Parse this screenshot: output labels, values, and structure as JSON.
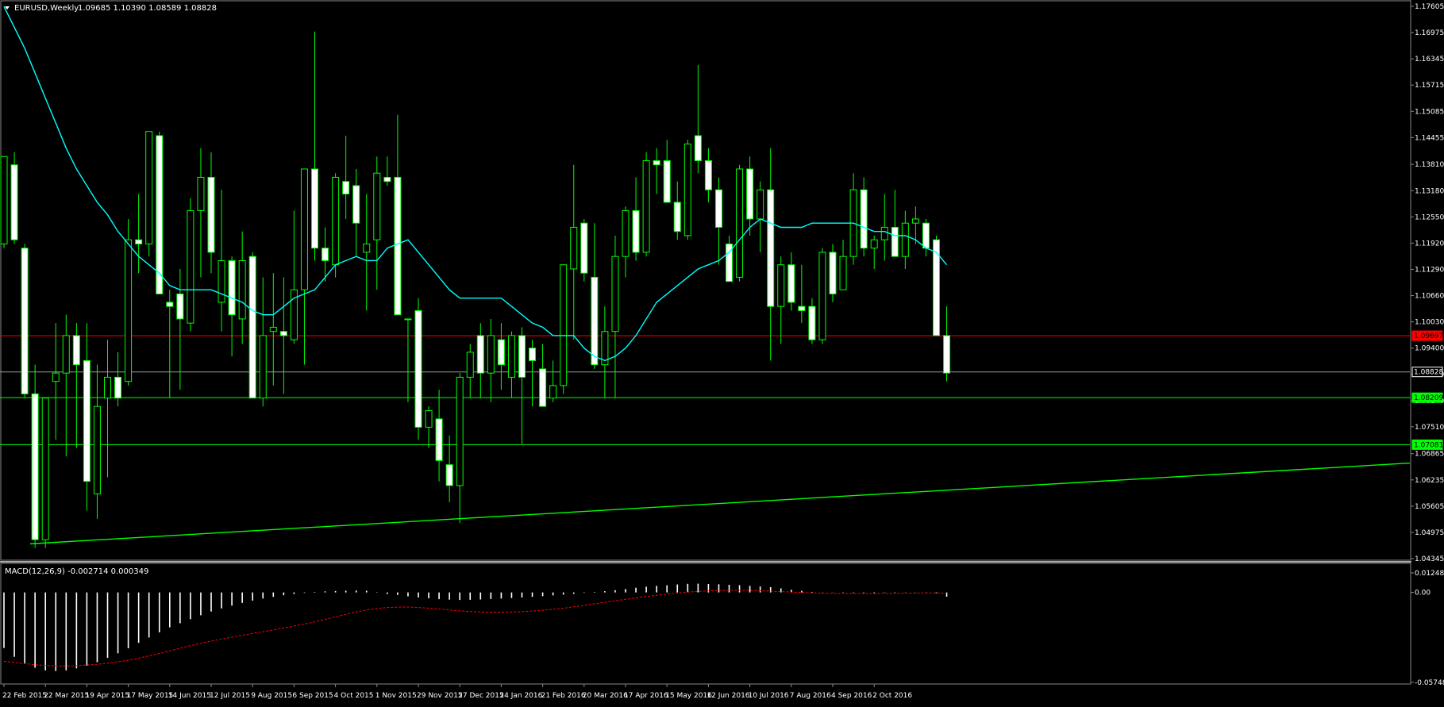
{
  "header": {
    "symbol_label": "EURUSD,Weekly",
    "ohlc_text": "1.09685 1.10390 1.08589 1.08828"
  },
  "macd_header": {
    "label": "MACD(12,26,9) -0.002714 0.000349"
  },
  "colors": {
    "background": "#000000",
    "bull_candle": "#000000",
    "bear_candle": "#ffffff",
    "wick": "#00ff00",
    "ma_line": "#00ffff",
    "red_level": "#ff0000",
    "green_level": "#00ff00",
    "macd_hist": "#ffffff",
    "macd_signal": "#ff0000",
    "axis_text": "#ffffff"
  },
  "chart_data": [
    {
      "type": "candlestick",
      "symbol": "EURUSD",
      "timeframe": "Weekly",
      "ylim": [
        1.04345,
        1.17605
      ],
      "y_ticks": [
        "1.17605",
        "1.16975",
        "1.16345",
        "1.15715",
        "1.15085",
        "1.14455",
        "1.13810",
        "1.13180",
        "1.12550",
        "1.11920",
        "1.11290",
        "1.10660",
        "1.10030",
        "1.09400",
        "1.08770",
        "1.08140",
        "1.07510",
        "1.06865",
        "1.06235",
        "1.05605",
        "1.04975",
        "1.04345"
      ],
      "x_labels": [
        "22 Feb 2015",
        "22 Mar 2015",
        "19 Apr 2015",
        "17 May 2015",
        "14 Jun 2015",
        "12 Jul 2015",
        "9 Aug 2015",
        "6 Sep 2015",
        "4 Oct 2015",
        "1 Nov 2015",
        "29 Nov 2015",
        "27 Dec 2015",
        "24 Jan 2016",
        "21 Feb 2016",
        "20 Mar 2016",
        "17 Apr 2016",
        "15 May 2016",
        "12 Jun 2016",
        "10 Jul 2016",
        "7 Aug 2016",
        "4 Sep 2016",
        "2 Oct 2016"
      ],
      "price_labels": [
        {
          "value": "1.09697",
          "kind": "red"
        },
        {
          "value": "1.08828",
          "kind": "current"
        },
        {
          "value": "1.08209",
          "kind": "green"
        },
        {
          "value": "1.07081",
          "kind": "green"
        }
      ],
      "horizontal_levels": [
        1.09697,
        1.08828,
        1.08209,
        1.07081
      ],
      "trendline": {
        "from": [
          0,
          1.047
        ],
        "to": [
          112,
          1.063
        ]
      },
      "candles": [
        {
          "o": 1.119,
          "h": 1.14,
          "l": 1.118,
          "c": 1.14
        },
        {
          "o": 1.138,
          "h": 1.141,
          "l": 1.119,
          "c": 1.12
        },
        {
          "o": 1.118,
          "h": 1.119,
          "l": 1.082,
          "c": 1.083
        },
        {
          "o": 1.083,
          "h": 1.09,
          "l": 1.046,
          "c": 1.048
        },
        {
          "o": 1.048,
          "h": 1.082,
          "l": 1.046,
          "c": 1.082
        },
        {
          "o": 1.086,
          "h": 1.1,
          "l": 1.072,
          "c": 1.088
        },
        {
          "o": 1.088,
          "h": 1.102,
          "l": 1.068,
          "c": 1.097
        },
        {
          "o": 1.097,
          "h": 1.1,
          "l": 1.07,
          "c": 1.09
        },
        {
          "o": 1.091,
          "h": 1.1,
          "l": 1.055,
          "c": 1.062
        },
        {
          "o": 1.059,
          "h": 1.09,
          "l": 1.053,
          "c": 1.08
        },
        {
          "o": 1.082,
          "h": 1.096,
          "l": 1.063,
          "c": 1.087
        },
        {
          "o": 1.087,
          "h": 1.093,
          "l": 1.08,
          "c": 1.082
        },
        {
          "o": 1.086,
          "h": 1.125,
          "l": 1.085,
          "c": 1.12
        },
        {
          "o": 1.12,
          "h": 1.131,
          "l": 1.112,
          "c": 1.119
        },
        {
          "o": 1.119,
          "h": 1.146,
          "l": 1.116,
          "c": 1.146
        },
        {
          "o": 1.145,
          "h": 1.146,
          "l": 1.107,
          "c": 1.107
        },
        {
          "o": 1.105,
          "h": 1.108,
          "l": 1.082,
          "c": 1.104
        },
        {
          "o": 1.107,
          "h": 1.113,
          "l": 1.084,
          "c": 1.101
        },
        {
          "o": 1.1,
          "h": 1.13,
          "l": 1.098,
          "c": 1.127
        },
        {
          "o": 1.127,
          "h": 1.142,
          "l": 1.111,
          "c": 1.135
        },
        {
          "o": 1.135,
          "h": 1.141,
          "l": 1.112,
          "c": 1.117
        },
        {
          "o": 1.105,
          "h": 1.132,
          "l": 1.098,
          "c": 1.115
        },
        {
          "o": 1.115,
          "h": 1.116,
          "l": 1.092,
          "c": 1.102
        },
        {
          "o": 1.101,
          "h": 1.122,
          "l": 1.095,
          "c": 1.115
        },
        {
          "o": 1.116,
          "h": 1.117,
          "l": 1.082,
          "c": 1.082
        },
        {
          "o": 1.082,
          "h": 1.111,
          "l": 1.08,
          "c": 1.097
        },
        {
          "o": 1.098,
          "h": 1.112,
          "l": 1.085,
          "c": 1.099
        },
        {
          "o": 1.098,
          "h": 1.111,
          "l": 1.083,
          "c": 1.097
        },
        {
          "o": 1.096,
          "h": 1.127,
          "l": 1.095,
          "c": 1.108
        },
        {
          "o": 1.108,
          "h": 1.134,
          "l": 1.09,
          "c": 1.137
        },
        {
          "o": 1.137,
          "h": 1.17,
          "l": 1.115,
          "c": 1.118
        },
        {
          "o": 1.118,
          "h": 1.123,
          "l": 1.11,
          "c": 1.115
        },
        {
          "o": 1.114,
          "h": 1.136,
          "l": 1.111,
          "c": 1.135
        },
        {
          "o": 1.134,
          "h": 1.145,
          "l": 1.125,
          "c": 1.131
        },
        {
          "o": 1.133,
          "h": 1.137,
          "l": 1.116,
          "c": 1.124
        },
        {
          "o": 1.117,
          "h": 1.131,
          "l": 1.103,
          "c": 1.119
        },
        {
          "o": 1.12,
          "h": 1.14,
          "l": 1.108,
          "c": 1.136
        },
        {
          "o": 1.135,
          "h": 1.14,
          "l": 1.133,
          "c": 1.134
        },
        {
          "o": 1.135,
          "h": 1.15,
          "l": 1.102,
          "c": 1.102
        },
        {
          "o": 1.101,
          "h": 1.101,
          "l": 1.081,
          "c": 1.101
        },
        {
          "o": 1.103,
          "h": 1.106,
          "l": 1.072,
          "c": 1.075
        },
        {
          "o": 1.075,
          "h": 1.08,
          "l": 1.07,
          "c": 1.079
        },
        {
          "o": 1.077,
          "h": 1.084,
          "l": 1.062,
          "c": 1.067
        },
        {
          "o": 1.066,
          "h": 1.073,
          "l": 1.057,
          "c": 1.061
        },
        {
          "o": 1.061,
          "h": 1.088,
          "l": 1.052,
          "c": 1.087
        },
        {
          "o": 1.087,
          "h": 1.095,
          "l": 1.082,
          "c": 1.093
        },
        {
          "o": 1.097,
          "h": 1.1,
          "l": 1.082,
          "c": 1.088
        },
        {
          "o": 1.088,
          "h": 1.101,
          "l": 1.081,
          "c": 1.097
        },
        {
          "o": 1.096,
          "h": 1.1,
          "l": 1.084,
          "c": 1.09
        },
        {
          "o": 1.087,
          "h": 1.098,
          "l": 1.082,
          "c": 1.097
        },
        {
          "o": 1.097,
          "h": 1.099,
          "l": 1.071,
          "c": 1.087
        },
        {
          "o": 1.094,
          "h": 1.096,
          "l": 1.08,
          "c": 1.091
        },
        {
          "o": 1.089,
          "h": 1.095,
          "l": 1.081,
          "c": 1.08
        },
        {
          "o": 1.082,
          "h": 1.091,
          "l": 1.081,
          "c": 1.085
        },
        {
          "o": 1.085,
          "h": 1.114,
          "l": 1.083,
          "c": 1.114
        },
        {
          "o": 1.113,
          "h": 1.138,
          "l": 1.096,
          "c": 1.123
        },
        {
          "o": 1.124,
          "h": 1.125,
          "l": 1.11,
          "c": 1.112
        },
        {
          "o": 1.111,
          "h": 1.124,
          "l": 1.089,
          "c": 1.09
        },
        {
          "o": 1.09,
          "h": 1.104,
          "l": 1.082,
          "c": 1.098
        },
        {
          "o": 1.098,
          "h": 1.121,
          "l": 1.082,
          "c": 1.116
        },
        {
          "o": 1.116,
          "h": 1.128,
          "l": 1.111,
          "c": 1.127
        },
        {
          "o": 1.127,
          "h": 1.135,
          "l": 1.115,
          "c": 1.117
        },
        {
          "o": 1.117,
          "h": 1.141,
          "l": 1.116,
          "c": 1.139
        },
        {
          "o": 1.139,
          "h": 1.142,
          "l": 1.131,
          "c": 1.138
        },
        {
          "o": 1.139,
          "h": 1.144,
          "l": 1.129,
          "c": 1.129
        },
        {
          "o": 1.129,
          "h": 1.134,
          "l": 1.12,
          "c": 1.122
        },
        {
          "o": 1.121,
          "h": 1.144,
          "l": 1.12,
          "c": 1.143
        },
        {
          "o": 1.145,
          "h": 1.162,
          "l": 1.136,
          "c": 1.139
        },
        {
          "o": 1.139,
          "h": 1.142,
          "l": 1.129,
          "c": 1.132
        },
        {
          "o": 1.132,
          "h": 1.135,
          "l": 1.114,
          "c": 1.123
        },
        {
          "o": 1.119,
          "h": 1.121,
          "l": 1.11,
          "c": 1.11
        },
        {
          "o": 1.111,
          "h": 1.138,
          "l": 1.11,
          "c": 1.137
        },
        {
          "o": 1.137,
          "h": 1.14,
          "l": 1.121,
          "c": 1.125
        },
        {
          "o": 1.125,
          "h": 1.134,
          "l": 1.117,
          "c": 1.132
        },
        {
          "o": 1.132,
          "h": 1.142,
          "l": 1.091,
          "c": 1.104
        },
        {
          "o": 1.104,
          "h": 1.116,
          "l": 1.095,
          "c": 1.114
        },
        {
          "o": 1.114,
          "h": 1.117,
          "l": 1.103,
          "c": 1.105
        },
        {
          "o": 1.104,
          "h": 1.114,
          "l": 1.1,
          "c": 1.103
        },
        {
          "o": 1.104,
          "h": 1.106,
          "l": 1.095,
          "c": 1.096
        },
        {
          "o": 1.096,
          "h": 1.118,
          "l": 1.095,
          "c": 1.117
        },
        {
          "o": 1.117,
          "h": 1.119,
          "l": 1.105,
          "c": 1.107
        },
        {
          "o": 1.108,
          "h": 1.12,
          "l": 1.108,
          "c": 1.116
        },
        {
          "o": 1.116,
          "h": 1.136,
          "l": 1.114,
          "c": 1.132
        },
        {
          "o": 1.132,
          "h": 1.135,
          "l": 1.116,
          "c": 1.118
        },
        {
          "o": 1.118,
          "h": 1.121,
          "l": 1.113,
          "c": 1.12
        },
        {
          "o": 1.12,
          "h": 1.131,
          "l": 1.115,
          "c": 1.123
        },
        {
          "o": 1.123,
          "h": 1.132,
          "l": 1.116,
          "c": 1.116
        },
        {
          "o": 1.116,
          "h": 1.127,
          "l": 1.113,
          "c": 1.124
        },
        {
          "o": 1.124,
          "h": 1.128,
          "l": 1.119,
          "c": 1.125
        },
        {
          "o": 1.124,
          "h": 1.125,
          "l": 1.116,
          "c": 1.118
        },
        {
          "o": 1.12,
          "h": 1.121,
          "l": 1.11,
          "c": 1.097
        },
        {
          "o": 1.097,
          "h": 1.104,
          "l": 1.086,
          "c": 1.088
        }
      ],
      "ma_line": [
        1.176,
        1.171,
        1.166,
        1.16,
        1.154,
        1.148,
        1.142,
        1.137,
        1.133,
        1.129,
        1.126,
        1.122,
        1.119,
        1.116,
        1.114,
        1.112,
        1.109,
        1.108,
        1.108,
        1.108,
        1.108,
        1.107,
        1.106,
        1.105,
        1.103,
        1.102,
        1.102,
        1.104,
        1.106,
        1.107,
        1.108,
        1.111,
        1.114,
        1.115,
        1.116,
        1.115,
        1.115,
        1.118,
        1.119,
        1.12,
        1.117,
        1.114,
        1.111,
        1.108,
        1.106,
        1.106,
        1.106,
        1.106,
        1.106,
        1.104,
        1.102,
        1.1,
        1.099,
        1.097,
        1.097,
        1.097,
        1.094,
        1.092,
        1.091,
        1.092,
        1.094,
        1.097,
        1.101,
        1.105,
        1.107,
        1.109,
        1.111,
        1.113,
        1.114,
        1.115,
        1.117,
        1.12,
        1.123,
        1.125,
        1.124,
        1.123,
        1.123,
        1.123,
        1.124,
        1.124,
        1.124,
        1.124,
        1.124,
        1.123,
        1.122,
        1.122,
        1.121,
        1.121,
        1.12,
        1.118,
        1.117,
        1.114
      ]
    },
    {
      "type": "macd",
      "title": "MACD(12,26,9)",
      "ylim": [
        -0.057483,
        0.012483
      ],
      "y_ticks": [
        "0.012483",
        "0.00",
        "-0.057483"
      ],
      "histogram": [
        -0.0355,
        -0.0411,
        -0.0452,
        -0.0481,
        -0.0498,
        -0.0502,
        -0.0498,
        -0.0485,
        -0.0468,
        -0.0446,
        -0.0418,
        -0.0389,
        -0.0357,
        -0.0322,
        -0.0288,
        -0.0255,
        -0.0223,
        -0.0197,
        -0.0171,
        -0.0146,
        -0.0122,
        -0.0102,
        -0.0084,
        -0.0067,
        -0.0052,
        -0.0039,
        -0.0028,
        -0.0018,
        -0.001,
        -0.0003,
        0.0003,
        0.0007,
        0.0009,
        0.0011,
        0.0012,
        0.0011,
        -0.0002,
        -0.001,
        -0.0016,
        -0.0025,
        -0.0032,
        -0.0038,
        -0.0043,
        -0.0046,
        -0.0048,
        -0.0047,
        -0.0045,
        -0.0042,
        -0.0039,
        -0.0036,
        -0.0032,
        -0.0028,
        -0.0024,
        -0.0019,
        -0.0014,
        -0.0009,
        -0.0003,
        0.0003,
        0.0008,
        0.0014,
        0.0022,
        0.003,
        0.0037,
        0.0042,
        0.0046,
        0.0051,
        0.0055,
        0.0056,
        0.0054,
        0.0052,
        0.0049,
        0.0046,
        0.0042,
        0.0038,
        0.0034,
        0.0026,
        0.0017,
        0.001,
        0.0003,
        -0.0001,
        -0.0001,
        -0.0002,
        -0.0003,
        -0.0003,
        -0.0004,
        -0.0002,
        -0.0002,
        -0.0001,
        -0.0001,
        -0.0002,
        -0.0004,
        -0.0027
      ],
      "signal": [
        -0.044,
        -0.0447,
        -0.0455,
        -0.0462,
        -0.0467,
        -0.047,
        -0.047,
        -0.0468,
        -0.0464,
        -0.0459,
        -0.0452,
        -0.0443,
        -0.0433,
        -0.042,
        -0.0405,
        -0.039,
        -0.0374,
        -0.0356,
        -0.034,
        -0.0325,
        -0.0311,
        -0.0298,
        -0.0286,
        -0.0274,
        -0.0262,
        -0.0251,
        -0.0239,
        -0.0227,
        -0.0215,
        -0.0202,
        -0.0188,
        -0.0172,
        -0.0156,
        -0.014,
        -0.0125,
        -0.0112,
        -0.0103,
        -0.0096,
        -0.0094,
        -0.0093,
        -0.0096,
        -0.0101,
        -0.0106,
        -0.0112,
        -0.0118,
        -0.0122,
        -0.0125,
        -0.0126,
        -0.0126,
        -0.0125,
        -0.0123,
        -0.0119,
        -0.0114,
        -0.0108,
        -0.0101,
        -0.0092,
        -0.0083,
        -0.0073,
        -0.0063,
        -0.0053,
        -0.0044,
        -0.0035,
        -0.0026,
        -0.0018,
        -0.001,
        -0.0004,
        0.0002,
        0.0006,
        0.001,
        0.0012,
        0.0014,
        0.0014,
        0.0013,
        0.0011,
        0.0008,
        0.0005,
        0.0002,
        -0.0001,
        -0.0003,
        -0.0005,
        -0.0006,
        -0.0007,
        -0.0007,
        -0.0007,
        -0.0007,
        -0.0006,
        -0.0006,
        -0.0005,
        -0.0004,
        -0.0003,
        -0.0003,
        -0.0005
      ]
    }
  ]
}
